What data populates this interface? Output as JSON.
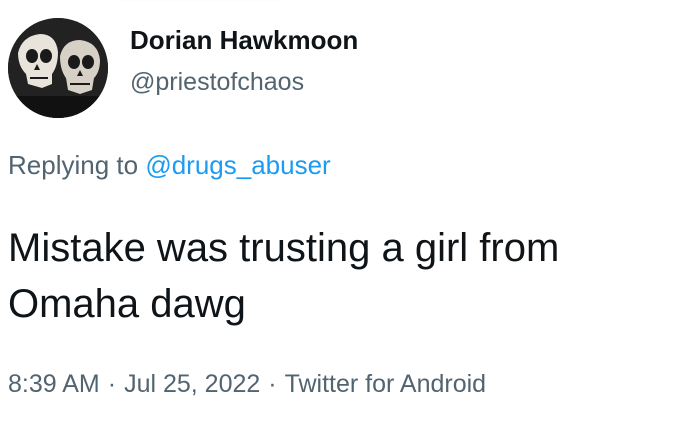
{
  "author": {
    "name": "Dorian Hawkmoon",
    "handle": "@priestofchaos"
  },
  "reply": {
    "prefix": "Replying to",
    "mention": "@drugs_abuser"
  },
  "tweet": {
    "text_line1": "Mistake was trusting a girl from",
    "text_line2": "Omaha dawg"
  },
  "meta": {
    "time": "8:39 AM",
    "date": "Jul 25, 2022",
    "source": "Twitter for Android",
    "separator": "·"
  },
  "colors": {
    "text": "#0f1419",
    "secondary": "#536471",
    "link": "#1d9bf0"
  }
}
